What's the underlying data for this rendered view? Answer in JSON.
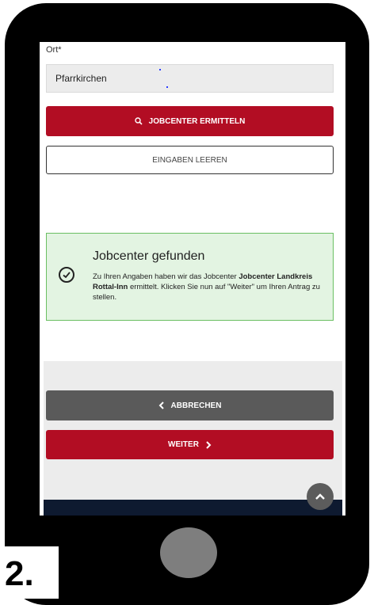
{
  "form": {
    "ort_label": "Ort*",
    "ort_value": "Pfarrkirchen"
  },
  "buttons": {
    "search_label": "JOBCENTER ERMITTELN",
    "clear_label": "EINGABEN LEEREN",
    "cancel_label": "ABBRECHEN",
    "next_label": "WEITER"
  },
  "alert": {
    "title": "Jobcenter gefunden",
    "text_prefix": "Zu Ihren Angaben haben wir das Jobcenter ",
    "text_bold": "Jobcenter Landkreis Rottal-Inn",
    "text_suffix": " ermittelt. Klicken Sie nun auf \"Weiter\" um Ihren Antrag zu stellen."
  },
  "step_label": "2.",
  "icons": {
    "search": "search-icon",
    "check": "check-circle-icon",
    "back": "chevron-left-icon",
    "forward": "chevron-right-icon",
    "scroll_top": "chevron-up-icon"
  },
  "colors": {
    "primary_red": "#b20d23",
    "success_bg": "#e3f4e2",
    "success_border": "#6abf62",
    "neutral_button": "#5a5a5a"
  }
}
